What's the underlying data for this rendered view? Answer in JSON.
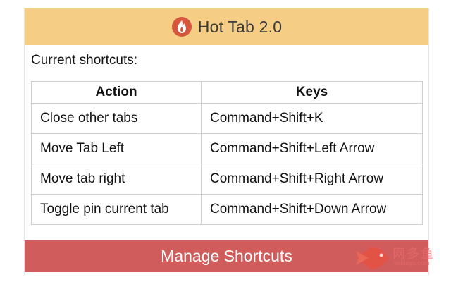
{
  "header": {
    "icon": "flame-icon",
    "title": "Hot Tab 2.0",
    "color": "#f5cd84"
  },
  "subtitle": "Current shortcuts:",
  "table": {
    "headers": [
      "Action",
      "Keys"
    ],
    "rows": [
      {
        "action": "Close other tabs",
        "keys": "Command+Shift+K"
      },
      {
        "action": "Move Tab Left",
        "keys": "Command+Shift+Left Arrow"
      },
      {
        "action": "Move tab right",
        "keys": "Command+Shift+Right Arrow"
      },
      {
        "action": "Toggle pin current tab",
        "keys": "Command+Shift+Down Arrow"
      }
    ]
  },
  "manage_button": {
    "label": "Manage Shortcuts",
    "color": "#d05c5c"
  },
  "watermark": {
    "text": "网多鱼",
    "sub": "wduoyu.com"
  }
}
